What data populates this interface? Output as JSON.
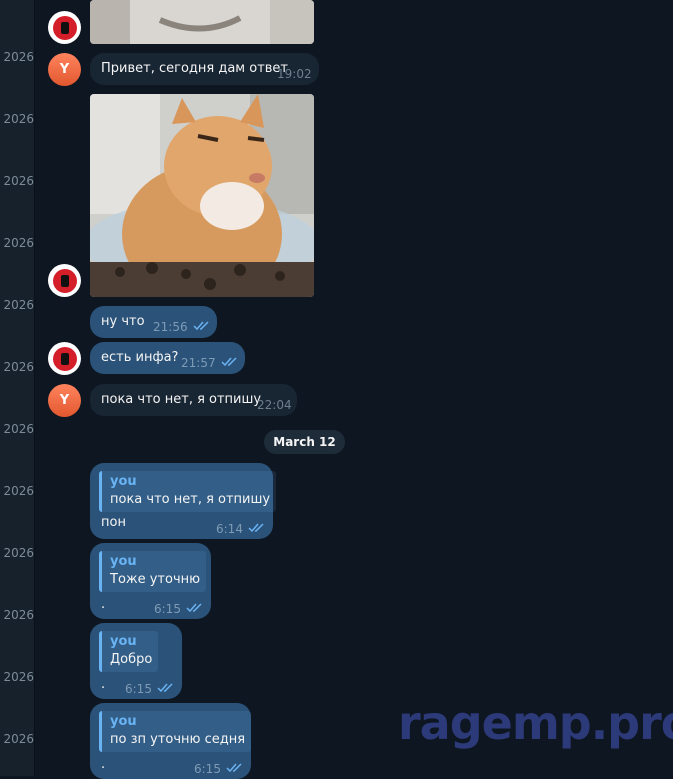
{
  "sidebar": {
    "year_label": "2026"
  },
  "avatars": {
    "letter": "Y"
  },
  "messages": {
    "m1": {
      "text": "Привет, сегодня дам ответ",
      "time": "19:02"
    },
    "m2": {
      "text": "ну что",
      "time": "21:56"
    },
    "m3": {
      "text": "есть инфа?",
      "time": "21:57"
    },
    "m4": {
      "text": "пока что нет, я отпишу",
      "time": "22:04"
    },
    "date_divider": "March 12",
    "r1": {
      "quote_name": "you",
      "quote_text": "пока что нет, я отпишу",
      "text": "пон",
      "time": "6:14"
    },
    "r2": {
      "quote_name": "you",
      "quote_text": "Тоже уточню",
      "text": ".",
      "time": "6:15"
    },
    "r3": {
      "quote_name": "you",
      "quote_text": "Добро",
      "text": ".",
      "time": "6:15"
    },
    "r4": {
      "quote_name": "you",
      "quote_text": "по зп уточню седня",
      "text": ".",
      "time": "6:15"
    }
  },
  "watermark": "ragemp.pro",
  "colors": {
    "background": "#0e1621",
    "incoming": "#182533",
    "outgoing": "#2b5278",
    "accent": "#6ab3f3"
  }
}
